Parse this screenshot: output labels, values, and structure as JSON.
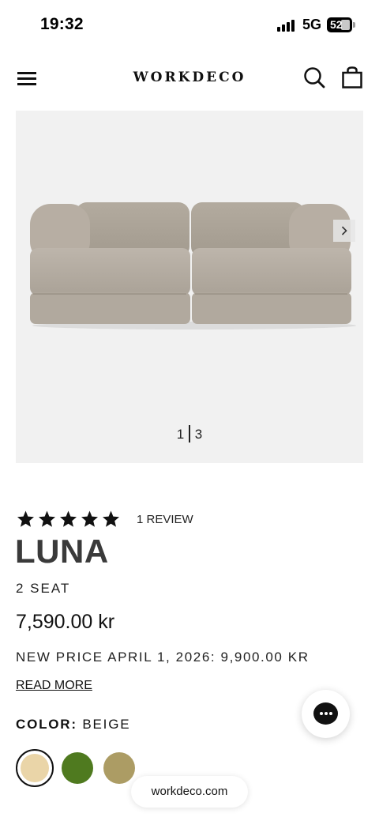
{
  "status_bar": {
    "time": "19:32",
    "network": "5G",
    "battery": "52"
  },
  "header": {
    "logo": "WORKDECO",
    "icons": [
      "menu-icon",
      "search-icon",
      "shopping-bag-icon"
    ]
  },
  "gallery": {
    "current": "1",
    "total": "3",
    "next_icon": "chevron-right-icon"
  },
  "product": {
    "rating_stars": 5,
    "review_count": "1 REVIEW",
    "title": "LUNA",
    "subtitle": "2 SEAT",
    "price": "7,590.00 kr",
    "price_note": "NEW PRICE APRIL 1, 2026: 9,900.00 KR",
    "read_more": "READ MORE",
    "color_label": "COLOR:",
    "color_value": "BEIGE",
    "swatches": [
      {
        "color": "#ead5a8",
        "selected": true
      },
      {
        "color": "#4f7a1f",
        "selected": false
      },
      {
        "color": "#ac9c64",
        "selected": false
      }
    ]
  },
  "chat": {
    "icon": "chat-icon"
  },
  "browser": {
    "url": "workdeco.com"
  }
}
